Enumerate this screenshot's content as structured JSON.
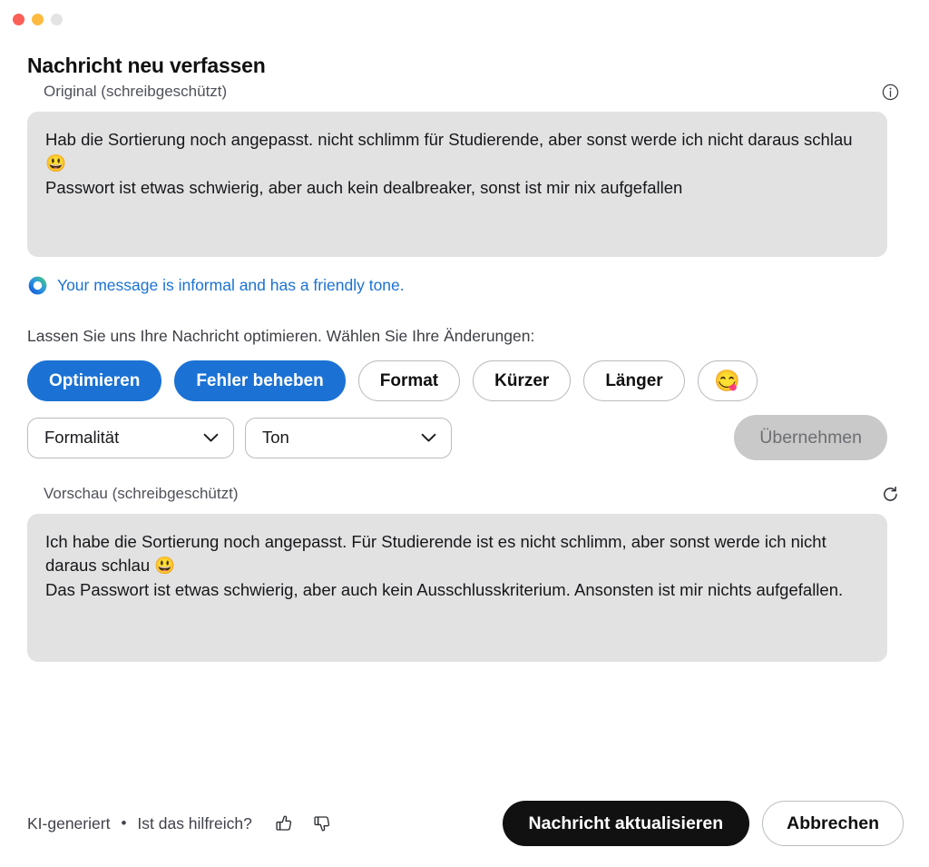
{
  "window": {
    "traffic_lights": [
      {
        "name": "close",
        "color": "#fc5f57"
      },
      {
        "name": "minimize",
        "color": "#fcbb40"
      },
      {
        "name": "maximize",
        "color": "#e3e3e3"
      }
    ]
  },
  "page_title": "Nachricht neu verfassen",
  "original": {
    "label": "Original (schreibgeschützt)",
    "info_icon": "info-circle-icon",
    "text": "Hab die Sortierung noch angepasst. nicht schlimm für Studierende, aber sonst werde ich nicht daraus schlau 😃\nPasswort ist etwas schwierig, aber auch kein dealbreaker, sonst ist mir nix aufgefallen"
  },
  "tone_notice": {
    "icon": "ai-ring-icon",
    "text": "Your message is informal and has a friendly tone.",
    "color": "#1b72d4"
  },
  "prompt": "Lassen Sie uns Ihre Nachricht optimieren. Wählen Sie Ihre Änderungen:",
  "chips": [
    {
      "label": "Optimieren",
      "active": true
    },
    {
      "label": "Fehler beheben",
      "active": true
    },
    {
      "label": "Format",
      "active": false
    },
    {
      "label": "Kürzer",
      "active": false
    },
    {
      "label": "Länger",
      "active": false
    },
    {
      "label": "😋",
      "active": false,
      "is_emoji": true
    }
  ],
  "selects": [
    {
      "value": "Formalität",
      "icon": "chevron-down-icon"
    },
    {
      "value": "Ton",
      "icon": "chevron-down-icon"
    }
  ],
  "apply_button": {
    "label": "Übernehmen",
    "disabled": true
  },
  "preview": {
    "label": "Vorschau (schreibgeschützt)",
    "refresh_icon": "refresh-icon",
    "text": "Ich habe die Sortierung noch angepasst. Für Studierende ist es nicht schlimm, aber sonst werde ich nicht daraus schlau 😃\nDas Passwort ist etwas schwierig, aber auch kein Ausschlusskriterium. Ansonsten ist mir nichts aufgefallen."
  },
  "footer": {
    "ai_label": "KI-generiert",
    "separator": "•",
    "feedback_question": "Ist das hilfreich?",
    "thumbs_up_icon": "thumbs-up-icon",
    "thumbs_down_icon": "thumbs-down-icon",
    "primary_button": "Nachricht aktualisieren",
    "secondary_button": "Abbrechen"
  },
  "colors": {
    "accent_blue": "#1b72d4",
    "textbox_bg": "#e2e2e2",
    "primary_btn_bg": "#111111",
    "disabled_btn_bg": "#c9c9c9"
  }
}
